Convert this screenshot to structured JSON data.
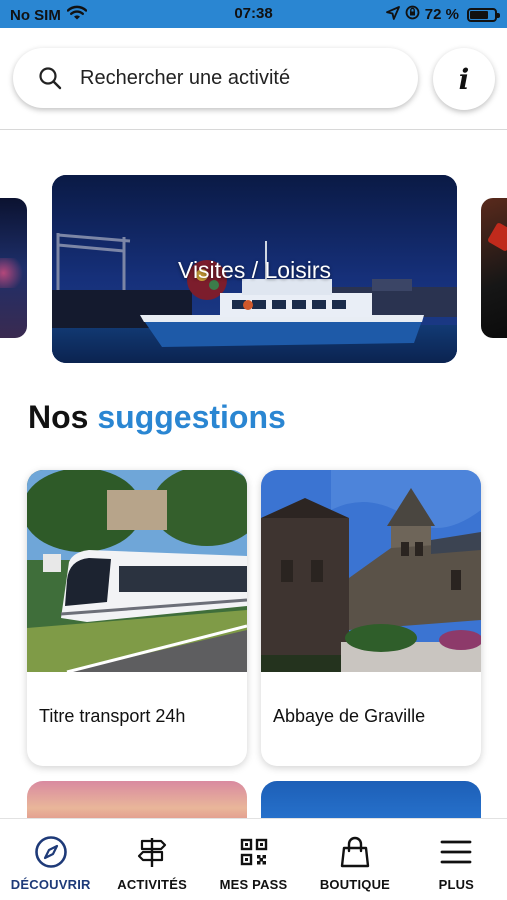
{
  "status_bar": {
    "carrier": "No SIM",
    "time": "07:38",
    "battery_percent": "72 %",
    "battery_level": 0.72,
    "icons": [
      "wifi-icon",
      "location-arrow-icon",
      "rotation-lock-icon",
      "battery-icon"
    ]
  },
  "search": {
    "placeholder": "Rechercher une activité",
    "icon": "search-icon"
  },
  "info_button": {
    "label": "i",
    "icon": "info-icon"
  },
  "carousel": {
    "items": [
      {
        "title": "Visites / Loisirs"
      }
    ]
  },
  "suggestions": {
    "title_prefix": "Nos",
    "title_accent": "suggestions",
    "accent_color": "#2a86d2",
    "items": [
      {
        "label": "Titre transport 24h"
      },
      {
        "label": "Abbaye de Graville"
      }
    ]
  },
  "bottom_nav": {
    "active_color": "#1e3a78",
    "items": [
      {
        "label": "DÉCOUVRIR",
        "icon": "compass-icon",
        "active": true
      },
      {
        "label": "ACTIVITÉS",
        "icon": "signpost-icon",
        "active": false
      },
      {
        "label": "MES PASS",
        "icon": "qr-code-icon",
        "active": false
      },
      {
        "label": "BOUTIQUE",
        "icon": "shopping-bag-icon",
        "active": false
      },
      {
        "label": "PLUS",
        "icon": "menu-icon",
        "active": false
      }
    ]
  }
}
